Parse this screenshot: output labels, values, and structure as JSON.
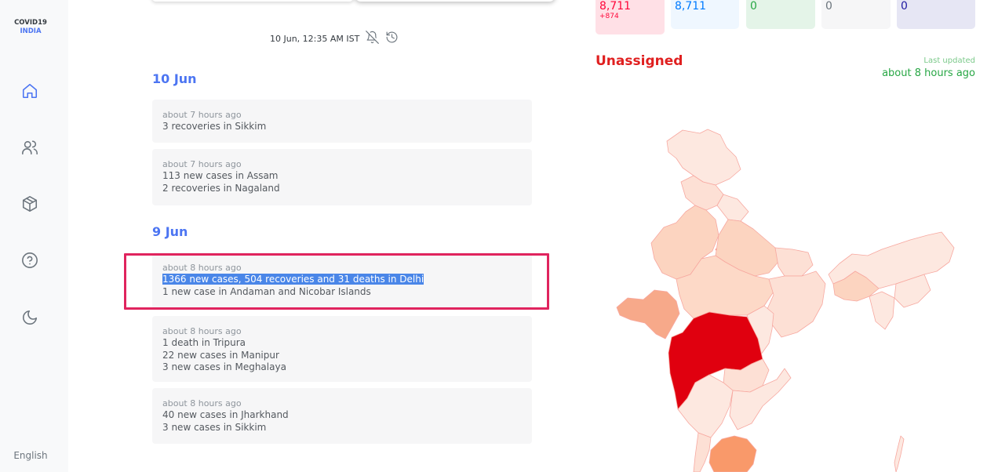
{
  "sidebar": {
    "logo_line1": "COVID19",
    "logo_line2": "INDIA",
    "language": "English",
    "icons": [
      "home-icon",
      "users-icon",
      "box-icon",
      "help-icon",
      "moon-icon"
    ]
  },
  "header": {
    "timestamp": "10 Jun, 12:35 AM IST",
    "icons": [
      "bell-off-icon",
      "history-icon"
    ]
  },
  "updates": {
    "groups": [
      {
        "date": "10 Jun",
        "items": [
          {
            "ago": "about 7 hours ago",
            "lines": [
              "3 recoveries in Sikkim"
            ]
          },
          {
            "ago": "about 7 hours ago",
            "lines": [
              "113 new cases in Assam",
              "2 recoveries in Nagaland"
            ]
          }
        ]
      },
      {
        "date": "9 Jun",
        "items": [
          {
            "ago": "about 8 hours ago",
            "lines": [
              "1366 new cases, 504 recoveries and 31 deaths in Delhi",
              "1 new case in Andaman and Nicobar Islands"
            ]
          },
          {
            "ago": "about 8 hours ago",
            "lines": [
              "1 death in Tripura",
              "22 new cases in Manipur",
              "3 new cases in Meghalaya"
            ]
          },
          {
            "ago": "about 8 hours ago",
            "lines": [
              "40 new cases in Jharkhand",
              "3 new cases in Sikkim"
            ]
          }
        ]
      }
    ]
  },
  "stats": {
    "confirmed": {
      "value": "8,711",
      "delta": "+874",
      "color": "#ff073a",
      "bg": "#ffe0e6"
    },
    "active": {
      "value": "8,711",
      "color": "#007bff",
      "bg": "#eff7ff"
    },
    "recovered": {
      "value": "0",
      "color": "#28a745",
      "bg": "#e4f4e8"
    },
    "deceased": {
      "value": "0",
      "color": "#6c757d",
      "bg": "#f6f6f7"
    },
    "tested": {
      "value": "0",
      "color": "#201aa2",
      "bg": "#e6e6f4"
    }
  },
  "map_panel": {
    "region": "Unassigned",
    "last_updated_label": "Last updated",
    "last_updated_value": "about 8 hours ago",
    "colors": {
      "max": "#e0000f",
      "high": "#f39a72",
      "mid": "#fbc7b0",
      "low": "#fde0d5",
      "stroke": "#f7a8a0"
    }
  }
}
